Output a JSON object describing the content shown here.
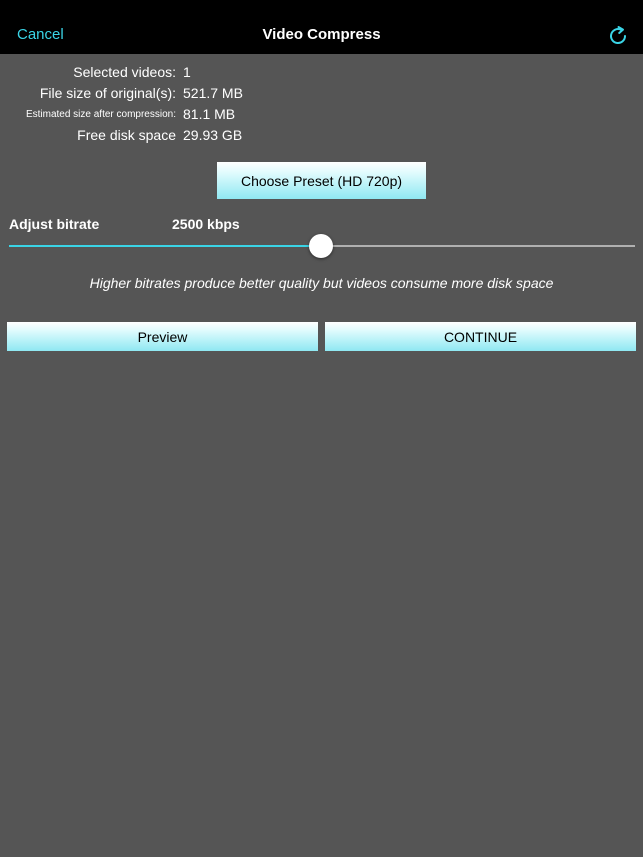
{
  "navbar": {
    "cancel_label": "Cancel",
    "title": "Video Compress",
    "refresh_icon": "refresh-icon"
  },
  "info": {
    "selected_label": "Selected videos:",
    "selected_value": "1",
    "original_label": "File size of original(s):",
    "original_value": "521.7 MB",
    "estimated_label": "Estimated size after compression:",
    "estimated_value": "81.1 MB",
    "disk_label": "Free disk space",
    "disk_value": "29.93 GB"
  },
  "preset_button_label": "Choose Preset (HD 720p)",
  "bitrate": {
    "label": "Adjust bitrate",
    "value_text": "2500 kbps",
    "slider_fraction": 0.499
  },
  "hint_text": "Higher bitrates produce better quality but videos consume more disk space",
  "actions": {
    "preview_label": "Preview",
    "continue_label": "CONTINUE"
  },
  "colors": {
    "accent": "#3ad4e6",
    "background": "#555555",
    "navbar": "#000000"
  }
}
